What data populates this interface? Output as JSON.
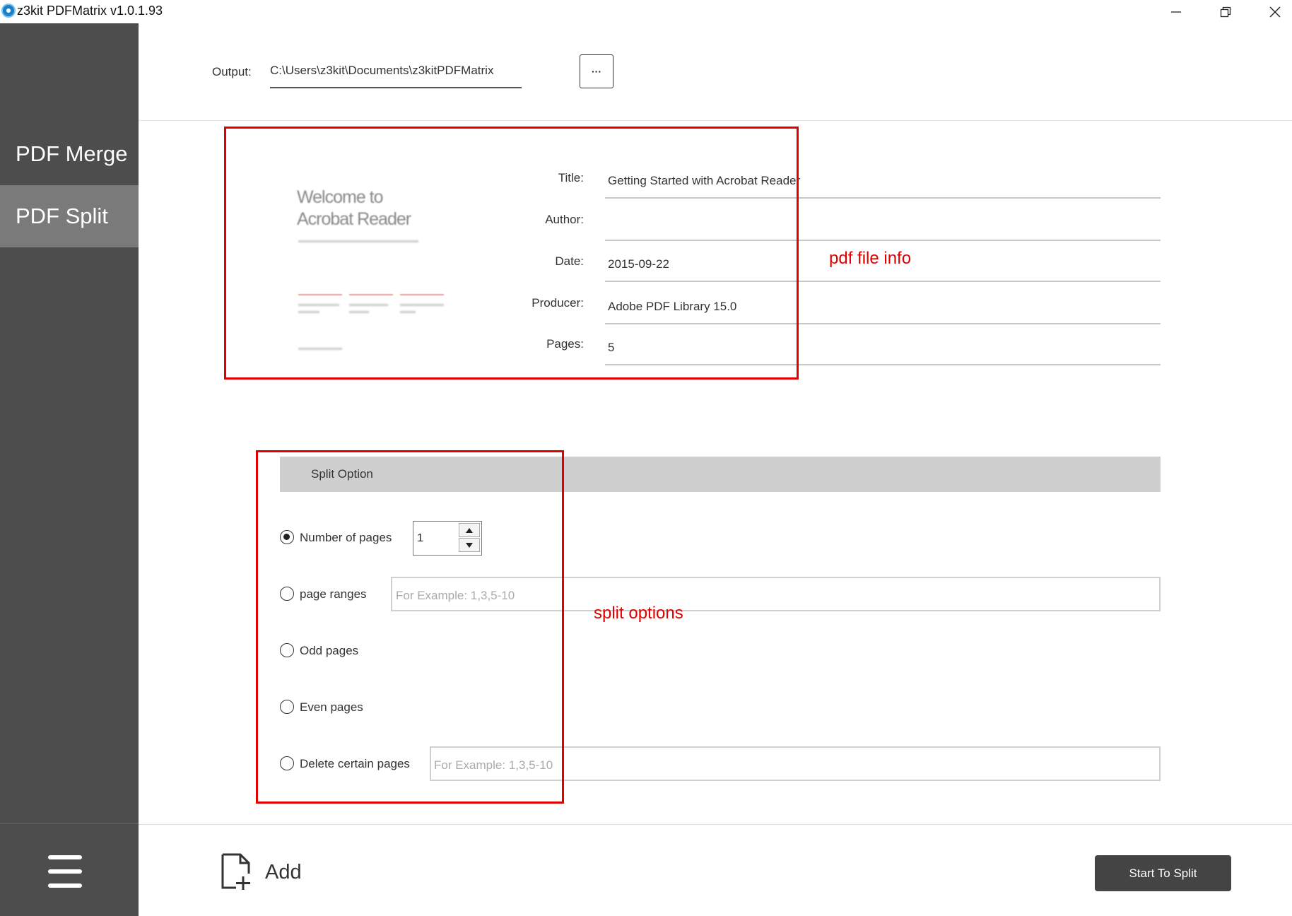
{
  "window": {
    "title": "z3kit PDFMatrix v1.0.1.93",
    "controls": [
      "minimize",
      "restore",
      "close"
    ]
  },
  "sidebar": {
    "items": [
      {
        "label": "PDF Merge",
        "active": false
      },
      {
        "label": "PDF Split",
        "active": true
      }
    ],
    "menu_icon": "hamburger-menu-icon"
  },
  "output": {
    "label": "Output:",
    "path": "C:\\Users\\z3kit\\Documents\\z3kitPDFMatrix",
    "browse_label": "···"
  },
  "preview": {
    "title_line1": "Welcome to",
    "title_line2": "Acrobat Reader"
  },
  "pdf_info": {
    "title_label": "Title:",
    "title_value": "Getting Started with Acrobat Reader",
    "author_label": "Author:",
    "author_value": "",
    "date_label": "Date:",
    "date_value": "2015-09-22",
    "producer_label": "Producer:",
    "producer_value": "Adobe PDF Library 15.0",
    "pages_label": "Pages:",
    "pages_value": "5"
  },
  "annotations": {
    "file_info": "pdf file info",
    "split_options": "split options",
    "color": "#e00000"
  },
  "split": {
    "header": "Split Option",
    "options": [
      {
        "label": "Number of pages",
        "checked": true
      },
      {
        "label": "page ranges",
        "checked": false
      },
      {
        "label": "Odd pages",
        "checked": false
      },
      {
        "label": "Even pages",
        "checked": false
      },
      {
        "label": "Delete certain pages",
        "checked": false
      }
    ],
    "pages_value": "1",
    "ranges_placeholder": "For Example: 1,3,5-10",
    "delete_placeholder": "For Example: 1,3,5-10"
  },
  "footer": {
    "add_label": "Add",
    "start_label": "Start To Split"
  }
}
